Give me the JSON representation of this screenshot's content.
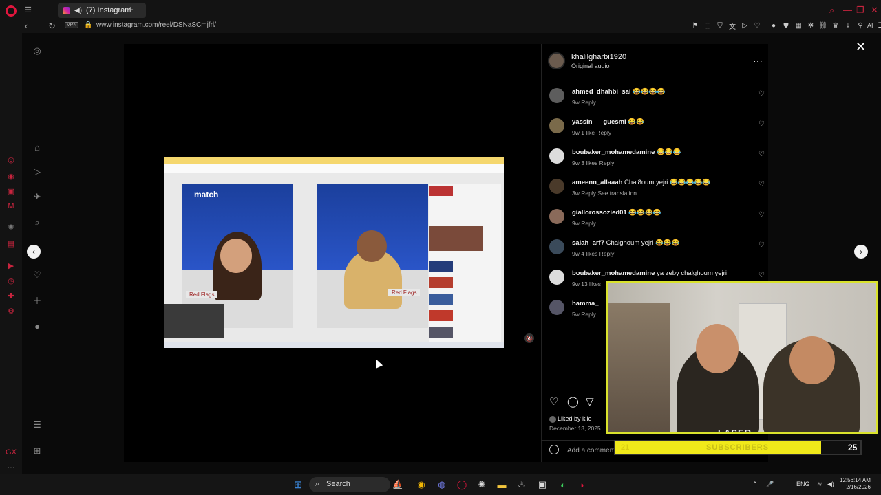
{
  "browser": {
    "tab_title": "(7) Instagram",
    "tab_sound_icon": "speaker-icon",
    "new_tab": "+",
    "url": "www.instagram.com/reel/DSNaSCmjfrl/",
    "vpn_label": "VPN",
    "ai_label": "AI"
  },
  "post": {
    "author": "khalilgharbi1920",
    "audio": "Original audio",
    "more": "···",
    "close": "✕",
    "liked_by": "Liked by kile",
    "date": "December 13, 2025",
    "add_comment": "Add a comment..."
  },
  "video": {
    "brand": "match",
    "label_left": "Red Flags",
    "label_right": "Red Flags",
    "mute_icon": "🔇"
  },
  "comments": [
    {
      "user": "ahmed_dhahbi_sai",
      "text": "😂😂😂😂",
      "meta": "9w   Reply"
    },
    {
      "user": "yassin___guesmi",
      "text": "😂😂",
      "meta": "9w   1 like   Reply"
    },
    {
      "user": "boubaker_mohamedamine",
      "text": "😂😂😂",
      "meta": "9w   3 likes   Reply"
    },
    {
      "user": "ameenn_allaaah",
      "text": "Chal8oum yejri 😂😂😂😂😂",
      "meta": "3w   Reply   See translation"
    },
    {
      "user": "giallorossozied01",
      "text": "😂😂😂😂",
      "meta": "9w   Reply"
    },
    {
      "user": "salah_arf7",
      "text": "Chalghoum yejri 😂😂😂",
      "meta": "9w   4 likes   Reply"
    },
    {
      "user": "boubaker_mohamedamine",
      "text": "ya zeby chalghoum yejri",
      "meta": "9w   13 likes"
    },
    {
      "user": "hamma_",
      "text": "",
      "meta": "5w   Reply"
    }
  ],
  "stream": {
    "logo": "LASER",
    "subscribers_label": "SUBSCRIBERS",
    "sub_current": "21",
    "sub_goal": "25",
    "progress": 0.84
  },
  "taskbar": {
    "search": "Search",
    "lang": "ENG",
    "time": "12:56:14 AM",
    "date": "2/16/2026"
  },
  "colors": {
    "accent": "#e0163d",
    "cam_border": "#d9e22c",
    "sub_bar": "#f0e91a"
  }
}
